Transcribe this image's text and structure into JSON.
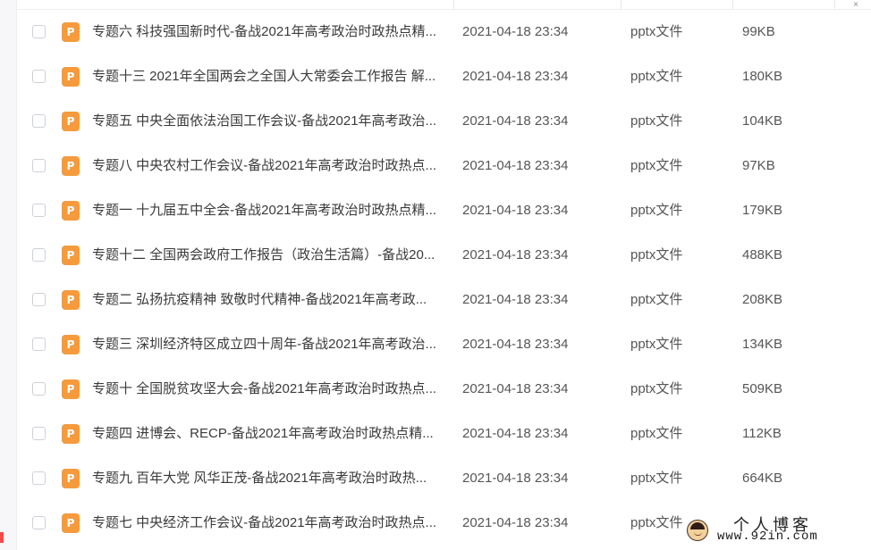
{
  "window": {
    "close_glyph": "×"
  },
  "files": [
    {
      "name": "专题六 科技强国新时代-备战2021年高考政治时政热点精...",
      "date": "2021-04-18 23:34",
      "type": "pptx文件",
      "size": "99KB",
      "icon_letter": "P"
    },
    {
      "name": "专题十三 2021年全国两会之全国人大常委会工作报告 解...",
      "date": "2021-04-18 23:34",
      "type": "pptx文件",
      "size": "180KB",
      "icon_letter": "P"
    },
    {
      "name": "专题五 中央全面依法治国工作会议-备战2021年高考政治...",
      "date": "2021-04-18 23:34",
      "type": "pptx文件",
      "size": "104KB",
      "icon_letter": "P"
    },
    {
      "name": "专题八 中央农村工作会议-备战2021年高考政治时政热点...",
      "date": "2021-04-18 23:34",
      "type": "pptx文件",
      "size": "97KB",
      "icon_letter": "P"
    },
    {
      "name": "专题一 十九届五中全会-备战2021年高考政治时政热点精...",
      "date": "2021-04-18 23:34",
      "type": "pptx文件",
      "size": "179KB",
      "icon_letter": "P"
    },
    {
      "name": "专题十二 全国两会政府工作报告（政治生活篇）-备战20...",
      "date": "2021-04-18 23:34",
      "type": "pptx文件",
      "size": "488KB",
      "icon_letter": "P"
    },
    {
      "name": "专题二 弘扬抗疫精神 致敬时代精神-备战2021年高考政...",
      "date": "2021-04-18 23:34",
      "type": "pptx文件",
      "size": "208KB",
      "icon_letter": "P"
    },
    {
      "name": "专题三 深圳经济特区成立四十周年-备战2021年高考政治...",
      "date": "2021-04-18 23:34",
      "type": "pptx文件",
      "size": "134KB",
      "icon_letter": "P"
    },
    {
      "name": "专题十 全国脱贫攻坚大会-备战2021年高考政治时政热点...",
      "date": "2021-04-18 23:34",
      "type": "pptx文件",
      "size": "509KB",
      "icon_letter": "P"
    },
    {
      "name": "专题四 进博会、RECP-备战2021年高考政治时政热点精...",
      "date": "2021-04-18 23:34",
      "type": "pptx文件",
      "size": "112KB",
      "icon_letter": "P"
    },
    {
      "name": "专题九 百年大党 风华正茂-备战2021年高考政治时政热...",
      "date": "2021-04-18 23:34",
      "type": "pptx文件",
      "size": "664KB",
      "icon_letter": "P"
    },
    {
      "name": "专题七 中央经济工作会议-备战2021年高考政治时政热点...",
      "date": "2021-04-18 23:34",
      "type": "pptx文件",
      "size": "",
      "icon_letter": "P"
    }
  ],
  "watermark": {
    "title": "个人博客",
    "url": "www.92in.com"
  },
  "colors": {
    "ppt_icon": "#f59b3d",
    "accent_red": "#ef4b4b",
    "checkbox_border": "#cdd0d6",
    "text_primary": "#3a3a3a",
    "text_secondary": "#555555"
  }
}
